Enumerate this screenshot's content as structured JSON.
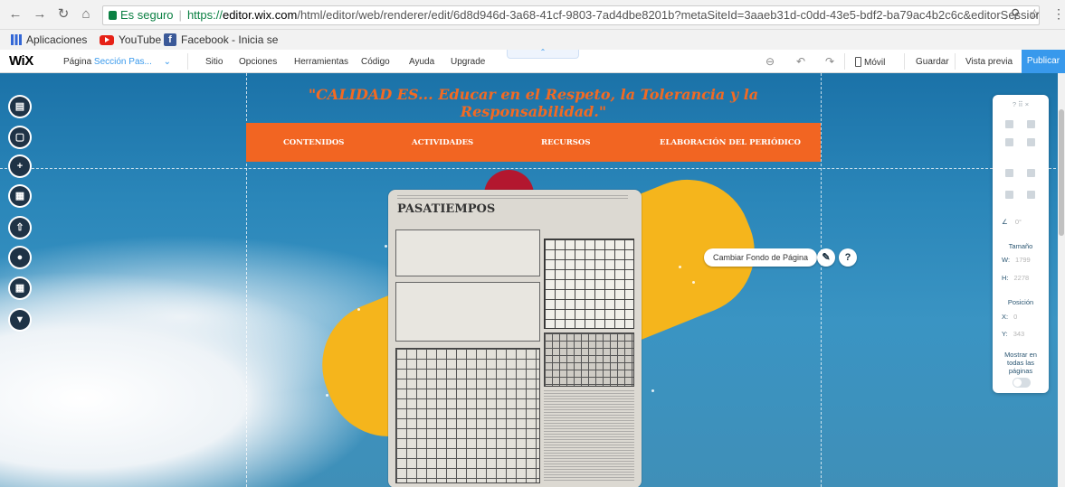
{
  "browser": {
    "back_icon": "back-arrow-icon",
    "forward_icon": "forward-arrow-icon",
    "reload_icon": "reload-icon",
    "home_icon": "home-icon",
    "secure_label": "Es seguro",
    "url_scheme": "https://",
    "url_host": "editor.wix.com",
    "url_path": "/html/editor/web/renderer/edit/6d8d946d-3a68-41cf-9803-7ad4dbe8201b?metaSiteId=3aaeb31d-c0dd-43e5-bdf2-ba79ac4b2c6c&editorSessionI...",
    "bookmarks": [
      {
        "label": "Aplicaciones",
        "icon": "apps-grid-icon"
      },
      {
        "label": "YouTube",
        "icon": "youtube-icon"
      },
      {
        "label": "Facebook - Inicia se",
        "icon": "facebook-icon"
      }
    ]
  },
  "wix_bar": {
    "logo": "WiX",
    "page_prefix": "Página",
    "page_name": "Sección Pas...",
    "menu": [
      "Sitio",
      "Opciones",
      "Herramientas",
      "Código",
      "Ayuda",
      "Upgrade"
    ],
    "mobile_label": "Móvil",
    "save_label": "Guardar",
    "preview_label": "Vista previa",
    "publish_label": "Publicar"
  },
  "site": {
    "motto": "\"CALIDAD ES... Educar en el Respeto, la Tolerancia y la Responsabilidad.\"",
    "nav": [
      "CONTENIDOS",
      "ACTIVIDADES",
      "RECURSOS",
      "ELABORACIÓN DEL PERIÓDICO"
    ],
    "newspaper_title": "PASATIEMPOS"
  },
  "canvas_actions": {
    "change_bg_label": "Cambiar Fondo de Página"
  },
  "inspector": {
    "top_controls": "?  ⠿  ×",
    "size_label": "Tamaño",
    "w_key": "W:",
    "w_val": "1799",
    "h_key": "H:",
    "h_val": "2278",
    "position_label": "Posición",
    "x_key": "X:",
    "x_val": "0",
    "y_key": "Y:",
    "y_val": "343",
    "rotation": "0°",
    "show_all_label": "Mostrar en todas las páginas"
  },
  "colors": {
    "accent": "#f26522",
    "wix_blue": "#3899ec",
    "dark_tool": "#1f3346"
  }
}
